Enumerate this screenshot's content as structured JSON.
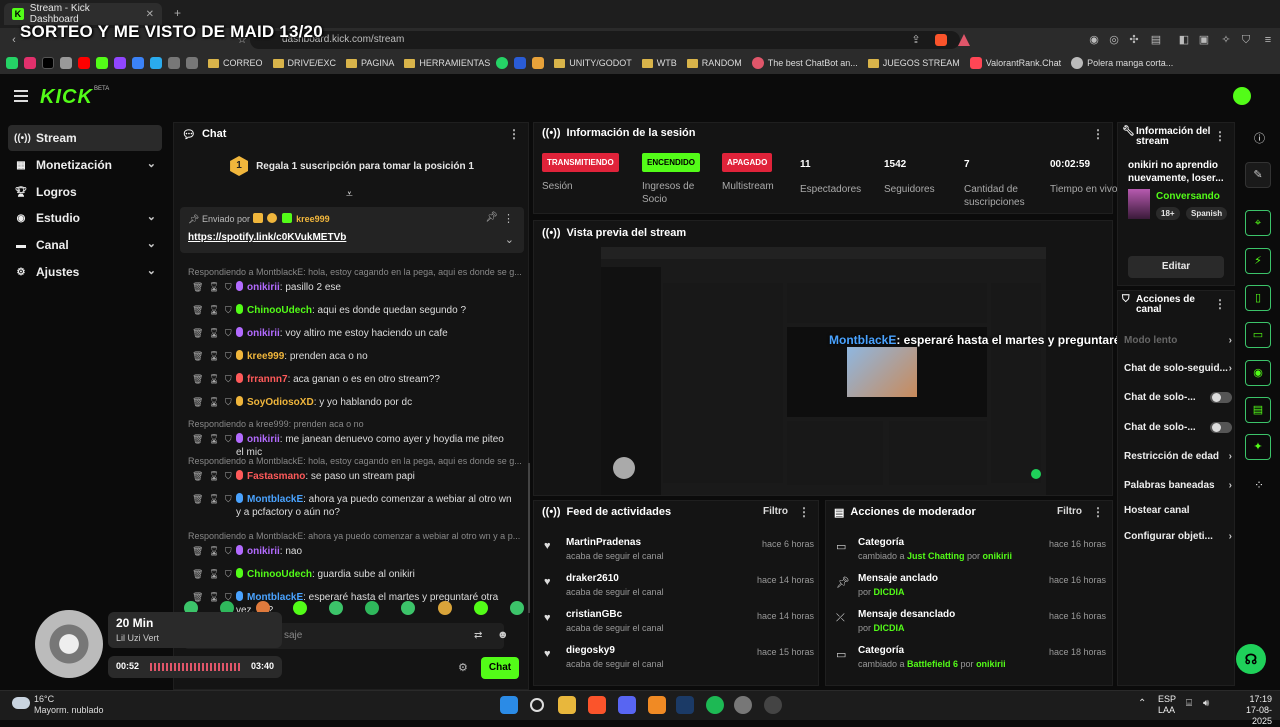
{
  "browser": {
    "tab_title": "Stream - Kick Dashboard",
    "url": "dashboard.kick.com/stream",
    "overlay_title": "SORTEO Y ME VISTO DE MAID 13/20",
    "bookmarks": [
      "CORREO",
      "DRIVE/EXC",
      "PAGINA",
      "HERRAMIENTAS",
      "UNITY/GODOT",
      "WTB",
      "RANDOM",
      "The best ChatBot an...",
      "JUEGOS STREAM",
      "ValorantRank.Chat",
      "Polera manga corta..."
    ]
  },
  "header": {
    "logo": "KICK",
    "beta": "BETA"
  },
  "sidebar": {
    "items": [
      {
        "label": "Stream"
      },
      {
        "label": "Monetización"
      },
      {
        "label": "Logros"
      },
      {
        "label": "Estudio"
      },
      {
        "label": "Canal"
      },
      {
        "label": "Ajustes"
      }
    ]
  },
  "chat": {
    "title": "Chat",
    "position_banner": "Regala 1 suscripción para tomar la posición 1",
    "position_number": "1",
    "pinned_by": "Enviado por",
    "pinned_user": "kree999",
    "pinned_link": "https://spotify.link/c0KVukMETVb",
    "messages": [
      {
        "reply": "Respondiendo a MontblackE: hola, estoy cagando en la pega, aqui es donde se g...",
        "user": "onikirii",
        "color": "#b36bff",
        "text": ": pasillo 2 ese"
      },
      {
        "user": "ChinooUdech",
        "color": "#53fc18",
        "text": ": aqui es donde quedan segundo ?"
      },
      {
        "user": "onikirii",
        "color": "#b36bff",
        "text": ": voy altiro me estoy haciendo un cafe"
      },
      {
        "user": "kree999",
        "color": "#f0b63c",
        "text": ": prenden aca o no"
      },
      {
        "user": "frrannn7",
        "color": "#ff5a5a",
        "text": ": aca ganan o es en otro stream??"
      },
      {
        "user": "SoyOdiosoXD",
        "color": "#f0b63c",
        "text": ": y yo hablando por dc"
      },
      {
        "reply": "Respondiendo a kree999: prenden aca o no",
        "user": "onikirii",
        "color": "#b36bff",
        "text": ": me janean denuevo como ayer y hoydia me piteo el mic"
      },
      {
        "reply": "Respondiendo a MontblackE: hola, estoy cagando en la pega, aqui es donde se g...",
        "user": "Fastasmano",
        "color": "#ff5a5a",
        "text": ": se paso un stream papi"
      },
      {
        "user": "MontblackE",
        "color": "#4aa3ff",
        "text": ": ahora ya puedo comenzar a webiar al otro wn y a pcfactory o aún no?"
      },
      {
        "reply": "Respondiendo a MontblackE: ahora ya puedo comenzar a webiar al otro wn y a p...",
        "user": "onikirii",
        "color": "#b36bff",
        "text": ": nao"
      },
      {
        "user": "ChinooUdech",
        "color": "#53fc18",
        "text": ": guardia sube al onikiri"
      },
      {
        "user": "MontblackE",
        "color": "#4aa3ff",
        "text": ": esperaré hasta el martes y preguntaré otra vez, ya?"
      }
    ],
    "input_placeholder": "saje",
    "send_label": "Chat"
  },
  "session": {
    "title": "Información de la sesión",
    "stats": [
      {
        "pill": "TRANSMITIENDO",
        "pill_color": "#e0233a",
        "label": "Sesión"
      },
      {
        "pill": "ENCENDIDO",
        "pill_color": "#53fc18",
        "label": "Ingresos de Socio"
      },
      {
        "pill": "APAGADO",
        "pill_color": "#e0233a",
        "label": "Multistream"
      },
      {
        "value": "11",
        "label": "Espectadores"
      },
      {
        "value": "1542",
        "label": "Seguidores"
      },
      {
        "value": "7",
        "label": "Cantidad de suscripciones"
      },
      {
        "value": "00:02:59",
        "label": "Tiempo en vivo"
      }
    ]
  },
  "preview": {
    "title": "Vista previa del stream",
    "caption_user": "MontblackE",
    "caption_text": ": esperaré hasta el martes y preguntaré otra vez, ya?"
  },
  "feed": {
    "title": "Feed de actividades",
    "filter": "Filtro",
    "items": [
      {
        "name": "MartinPradenas",
        "desc": "acaba de seguir el canal",
        "time": "hace 6 horas"
      },
      {
        "name": "draker2610",
        "desc": "acaba de seguir el canal",
        "time": "hace 14 horas"
      },
      {
        "name": "cristianGBc",
        "desc": "acaba de seguir el canal",
        "time": "hace 14 horas"
      },
      {
        "name": "diegosky9",
        "desc": "acaba de seguir el canal",
        "time": "hace 15 horas"
      }
    ]
  },
  "modactions": {
    "title": "Acciones de moderador",
    "filter": "Filtro",
    "items": [
      {
        "name": "Categoría",
        "desc_a": "cambiado a ",
        "hl": "Just Chatting",
        "desc_b": " por ",
        "by": "onikirii",
        "time": "hace 16 horas"
      },
      {
        "name": "Mensaje anclado",
        "desc_a": "por ",
        "hl": "DICDIA",
        "desc_b": "",
        "by": "",
        "time": "hace 16 horas"
      },
      {
        "name": "Mensaje desanclado",
        "desc_a": "por ",
        "hl": "DICDIA",
        "desc_b": "",
        "by": "",
        "time": "hace 16 horas"
      },
      {
        "name": "Categoría",
        "desc_a": "cambiado a ",
        "hl": "Battlefield 6",
        "desc_b": " por ",
        "by": "onikirii",
        "time": "hace 18 horas"
      }
    ]
  },
  "streaminfo": {
    "title": "Información del stream",
    "stream_title": "onikiri no aprendio nuevamente, loser...",
    "category": "Conversando",
    "tags": [
      "18+",
      "Spanish"
    ],
    "edit_label": "Editar"
  },
  "channel": {
    "title": "Acciones de canal",
    "rows": [
      "Modo lento",
      "Chat de solo-seguid...",
      "Chat de solo-...",
      "Chat de solo-...",
      "Restricción de edad",
      "Palabras baneadas",
      "Hostear canal",
      "Configurar objeti..."
    ]
  },
  "music": {
    "title": "20 Min",
    "artist": "Lil Uzi Vert",
    "elapsed": "00:52",
    "total": "03:40"
  },
  "taskbar": {
    "temp": "16°C",
    "weather": "Mayorm. nublado",
    "lang1": "ESP",
    "lang2": "LAA",
    "time": "17:19",
    "date": "17-08-2025"
  }
}
